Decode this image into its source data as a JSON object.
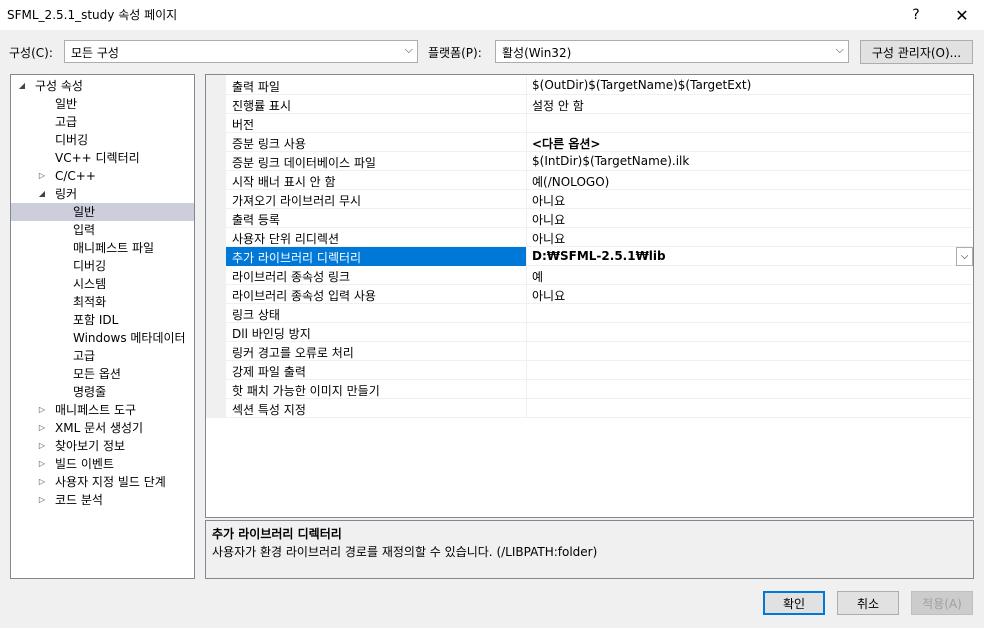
{
  "window": {
    "title": "SFML_2.5.1_study 속성 페이지",
    "help": "?",
    "close": "✕"
  },
  "config": {
    "label": "구성(C):",
    "value": "모든 구성",
    "platform_label": "플랫폼(P):",
    "platform_value": "활성(Win32)",
    "manager_button": "구성 관리자(O)..."
  },
  "tree": {
    "items": [
      {
        "label": "구성 속성",
        "exp": "◢"
      },
      {
        "label": "일반"
      },
      {
        "label": "고급"
      },
      {
        "label": "디버깅"
      },
      {
        "label": "VC++ 디렉터리"
      },
      {
        "label": "C/C++",
        "exp": "▷"
      },
      {
        "label": "링커",
        "exp": "◢"
      },
      {
        "label": "일반"
      },
      {
        "label": "입력"
      },
      {
        "label": "매니페스트 파일"
      },
      {
        "label": "디버깅"
      },
      {
        "label": "시스템"
      },
      {
        "label": "최적화"
      },
      {
        "label": "포함 IDL"
      },
      {
        "label": "Windows 메타데이터"
      },
      {
        "label": "고급"
      },
      {
        "label": "모든 옵션"
      },
      {
        "label": "명령줄"
      },
      {
        "label": "매니페스트 도구",
        "exp": "▷"
      },
      {
        "label": "XML 문서 생성기",
        "exp": "▷"
      },
      {
        "label": "찾아보기 정보",
        "exp": "▷"
      },
      {
        "label": "빌드 이벤트",
        "exp": "▷"
      },
      {
        "label": "사용자 지정 빌드 단계",
        "exp": "▷"
      },
      {
        "label": "코드 분석",
        "exp": "▷"
      }
    ]
  },
  "grid": {
    "rows": [
      {
        "name": "출력 파일",
        "value": "$(OutDir)$(TargetName)$(TargetExt)"
      },
      {
        "name": "진행률 표시",
        "value": "설정 안 함"
      },
      {
        "name": "버전",
        "value": ""
      },
      {
        "name": "증분 링크 사용",
        "value": "<다른 옵션>"
      },
      {
        "name": "증분 링크 데이터베이스 파일",
        "value": "$(IntDir)$(TargetName).ilk"
      },
      {
        "name": "시작 배너 표시 안 함",
        "value": "예(/NOLOGO)"
      },
      {
        "name": "가져오기 라이브러리 무시",
        "value": "아니요"
      },
      {
        "name": "출력 등록",
        "value": "아니요"
      },
      {
        "name": "사용자 단위 리디렉션",
        "value": "아니요"
      },
      {
        "name": "추가 라이브러리 디렉터리",
        "value": "D:₩SFML-2.5.1₩lib"
      },
      {
        "name": "라이브러리 종속성 링크",
        "value": "예"
      },
      {
        "name": "라이브러리 종속성 입력 사용",
        "value": "아니요"
      },
      {
        "name": "링크 상태",
        "value": ""
      },
      {
        "name": "Dll 바인딩 방지",
        "value": ""
      },
      {
        "name": "링커 경고를 오류로 처리",
        "value": ""
      },
      {
        "name": "강제 파일 출력",
        "value": ""
      },
      {
        "name": "핫 패치 가능한 이미지 만들기",
        "value": ""
      },
      {
        "name": "섹션 특성 지정",
        "value": ""
      }
    ]
  },
  "description": {
    "title": "추가 라이브러리 디렉터리",
    "text": "사용자가 환경 라이브러리 경로를 재정의할 수 있습니다. (/LIBPATH:folder)"
  },
  "buttons": {
    "ok": "확인",
    "cancel": "취소",
    "apply": "적용(A)"
  },
  "colors": {
    "selection": "#0078d7",
    "tree_selection": "#cccedb"
  }
}
